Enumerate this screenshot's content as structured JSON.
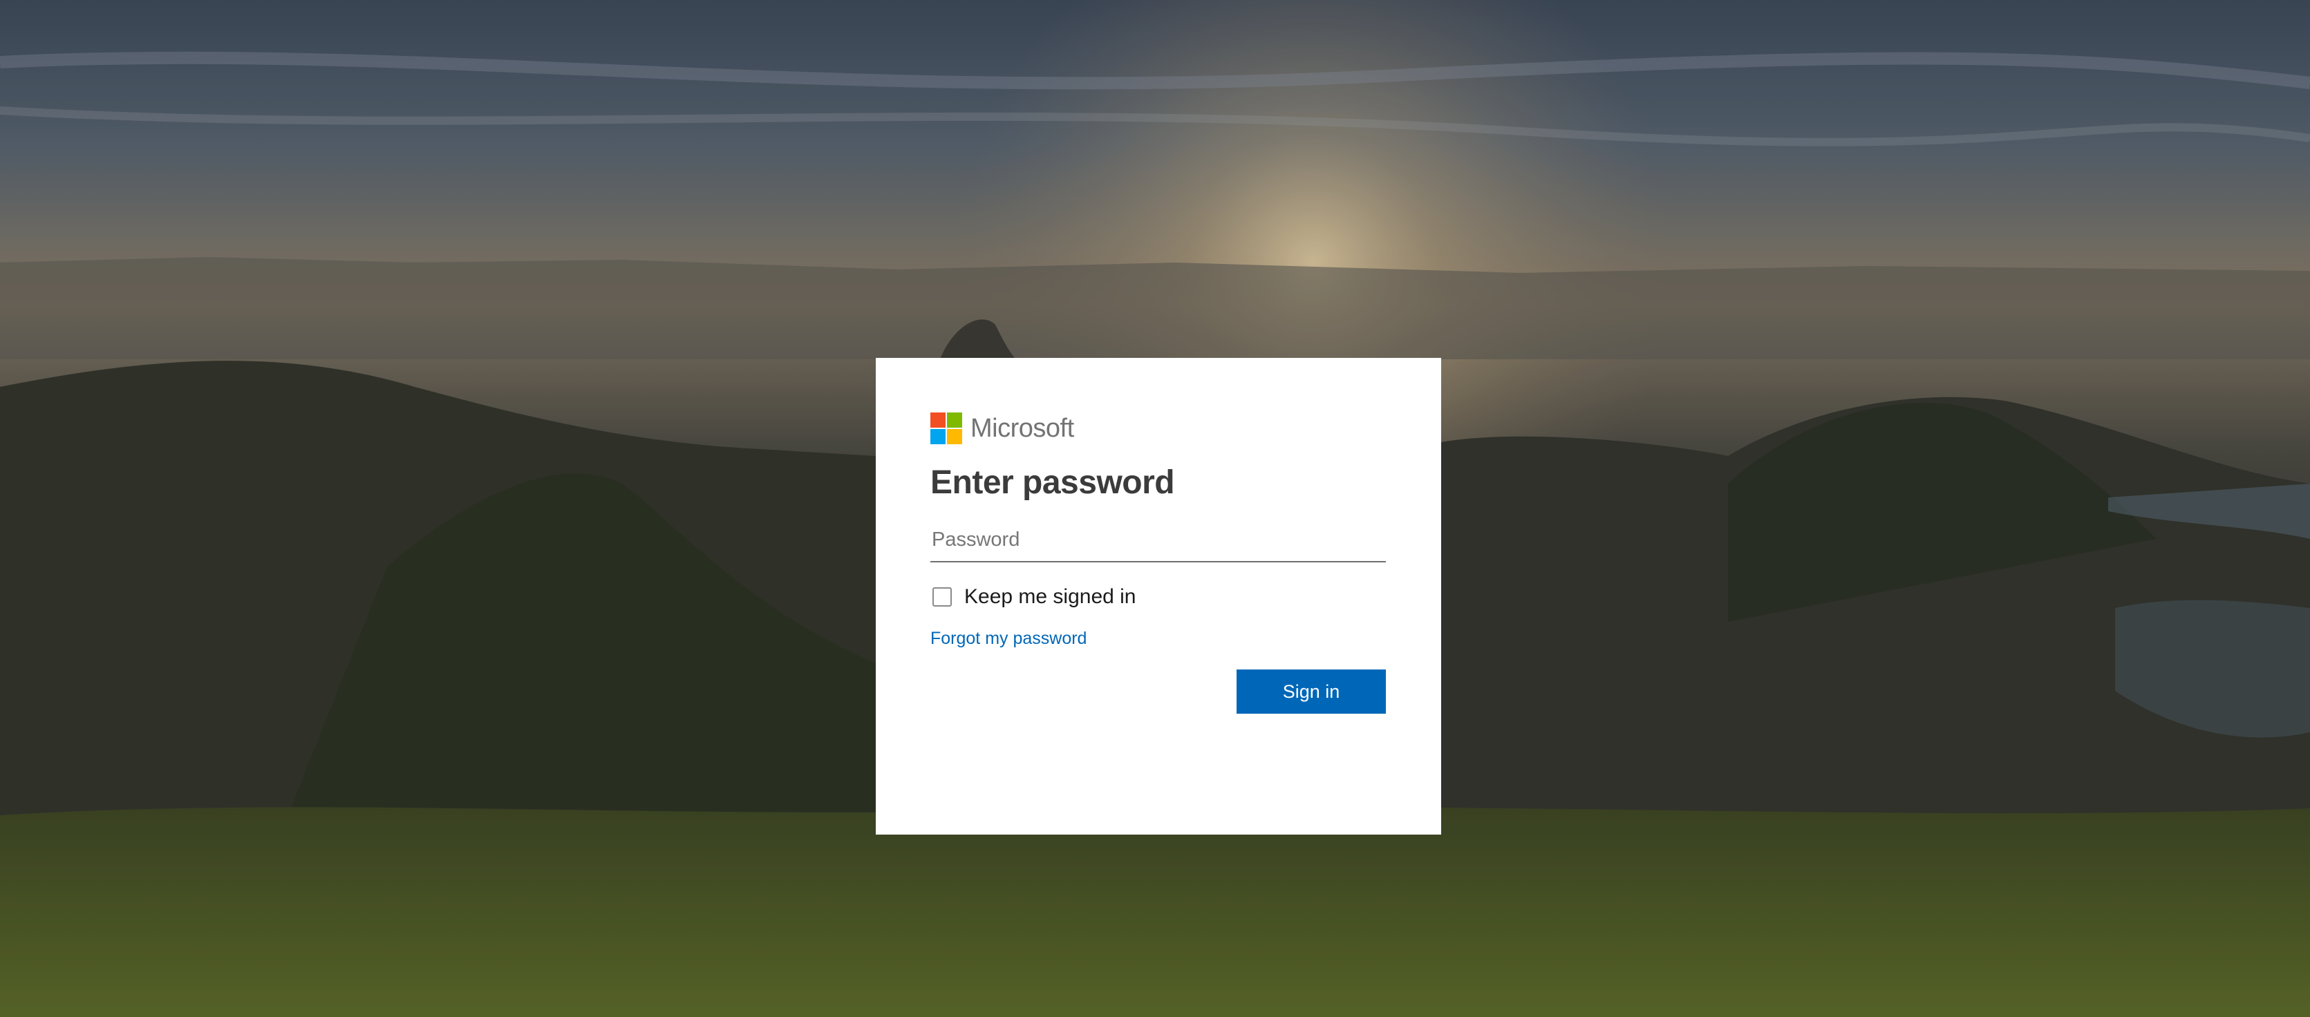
{
  "brand": {
    "name": "Microsoft",
    "logo_colors": [
      "#f25022",
      "#7fba00",
      "#00a4ef",
      "#ffb900"
    ]
  },
  "page": {
    "title": "Enter password"
  },
  "password": {
    "placeholder": "Password",
    "value": ""
  },
  "keep_signed_in": {
    "label": "Keep me signed in",
    "checked": false
  },
  "links": {
    "forgot_password": "Forgot my password"
  },
  "actions": {
    "signin_label": "Sign in",
    "accent_color": "#0067b8"
  },
  "background": {
    "description_icon": "landscape-background"
  }
}
